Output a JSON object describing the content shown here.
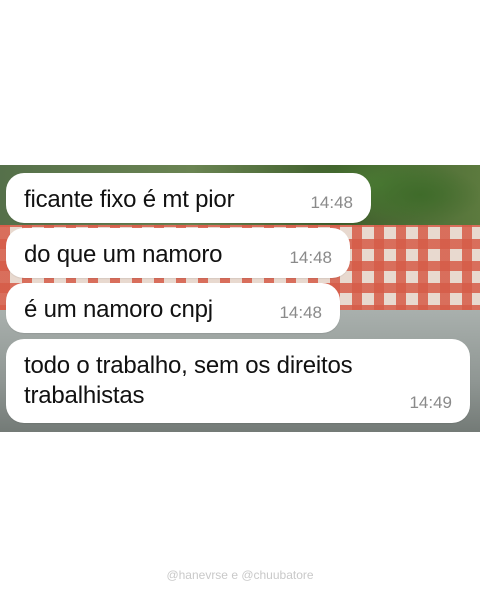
{
  "messages": [
    {
      "text": "ficante fixo é mt pior",
      "time": "14:48"
    },
    {
      "text": "do que um namoro",
      "time": "14:48"
    },
    {
      "text": "é um namoro cnpj",
      "time": "14:48"
    },
    {
      "text": "todo o trabalho, sem os direitos trabalhistas",
      "time": "14:49"
    }
  ],
  "credit": "@hanevrse e @chuubatore"
}
